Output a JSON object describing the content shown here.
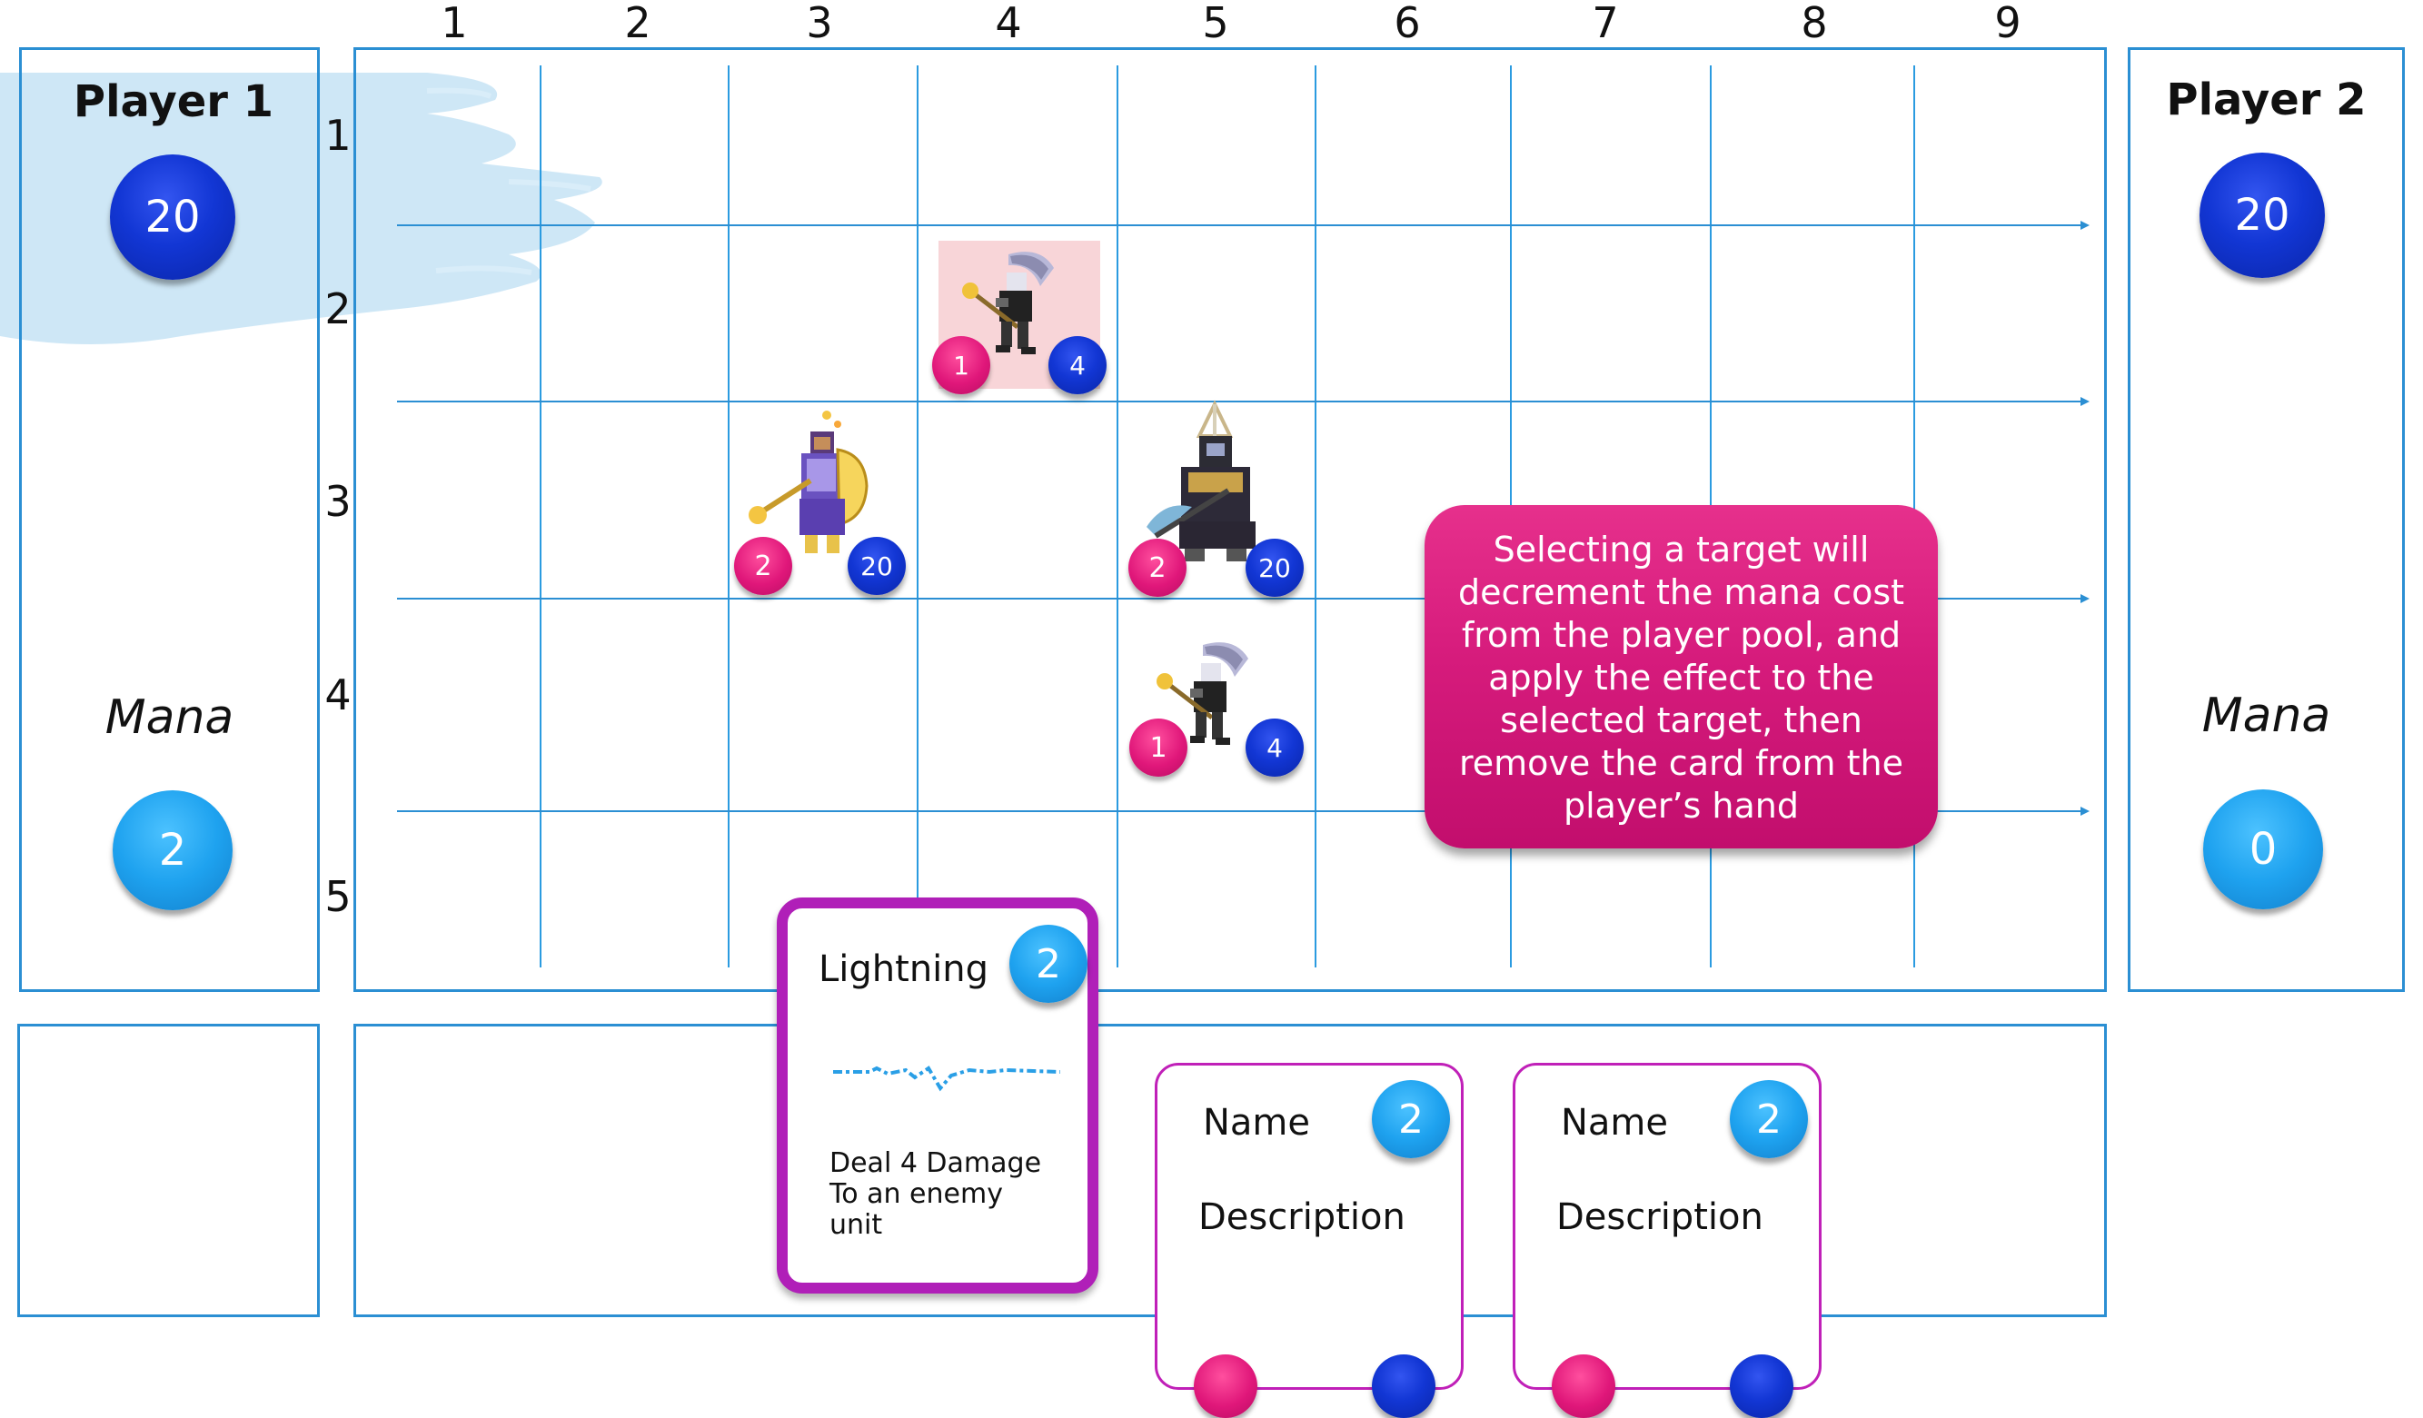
{
  "columns": [
    "1",
    "2",
    "3",
    "4",
    "5",
    "6",
    "7",
    "8",
    "9"
  ],
  "rows": [
    "1",
    "2",
    "3",
    "4",
    "5"
  ],
  "player1": {
    "title": "Player 1",
    "health": "20",
    "mana_label": "Mana",
    "mana": "2"
  },
  "player2": {
    "title": "Player 2",
    "health": "20",
    "mana_label": "Mana",
    "mana": "0"
  },
  "units": [
    {
      "name": "axe-warrior",
      "attack": "1",
      "health": "4",
      "selected": true
    },
    {
      "name": "paladin",
      "attack": "2",
      "health": "20"
    },
    {
      "name": "dark-knight",
      "attack": "2",
      "health": "20"
    },
    {
      "name": "axe-warrior",
      "attack": "1",
      "health": "4"
    }
  ],
  "callout": {
    "text": "Selecting a target will decrement the mana cost from the player pool, and apply the effect to the selected target, then remove the card from the player’s hand"
  },
  "hand": {
    "selected_card": {
      "name": "Lightning",
      "cost": "2",
      "description": "Deal 4 Damage To an enemy unit"
    },
    "cards": [
      {
        "name": "Name",
        "cost": "2",
        "description": "Description"
      },
      {
        "name": "Name",
        "cost": "2",
        "description": "Description"
      }
    ]
  },
  "colors": {
    "border": "#2b8fd3",
    "health": "#1236d4",
    "mana": "#1ea2ef",
    "attack": "#e0177a",
    "selected_card_border": "#b01fb8",
    "callout": "#d61b7c"
  }
}
